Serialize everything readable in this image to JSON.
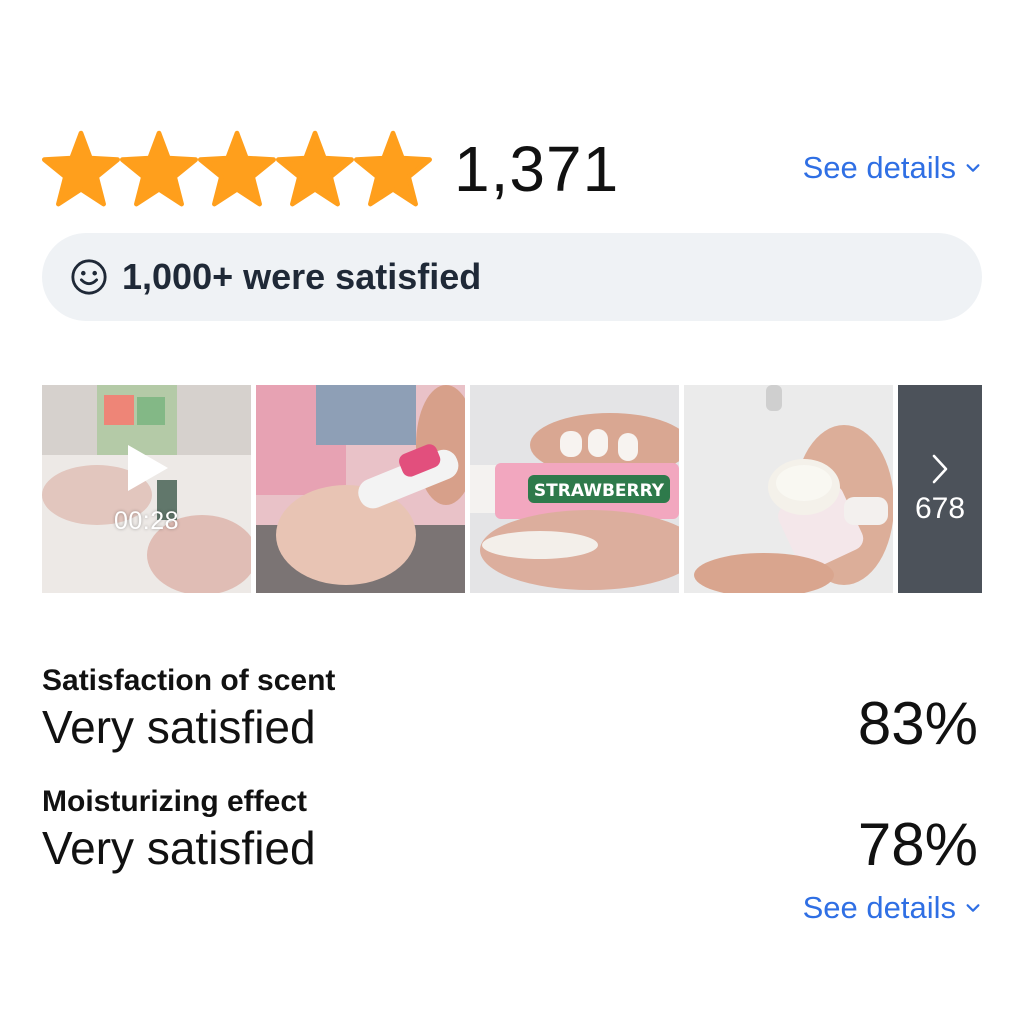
{
  "rating": {
    "stars": 5,
    "max_stars": 5,
    "count": "1,371",
    "star_color": "#ff9f1c",
    "see_details": "See details"
  },
  "satisfaction": {
    "icon": "smile-icon",
    "text": "1,000+ were satisfied"
  },
  "gallery": {
    "video_duration": "00:28",
    "more_count": "678",
    "thumbnails": [
      {
        "type": "video",
        "icon": "play-icon"
      },
      {
        "type": "image"
      },
      {
        "type": "image",
        "label": "STRAWBERRY"
      },
      {
        "type": "image"
      }
    ]
  },
  "metrics": [
    {
      "label": "Satisfaction of scent",
      "value": "Very satisfied",
      "percent": "83%"
    },
    {
      "label": "Moisturizing effect",
      "value": "Very satisfied",
      "percent": "78%"
    }
  ],
  "footer": {
    "see_details": "See details"
  },
  "colors": {
    "link": "#2f6fe4",
    "pill_bg": "#eff2f5",
    "more_bg": "#4c525a"
  }
}
